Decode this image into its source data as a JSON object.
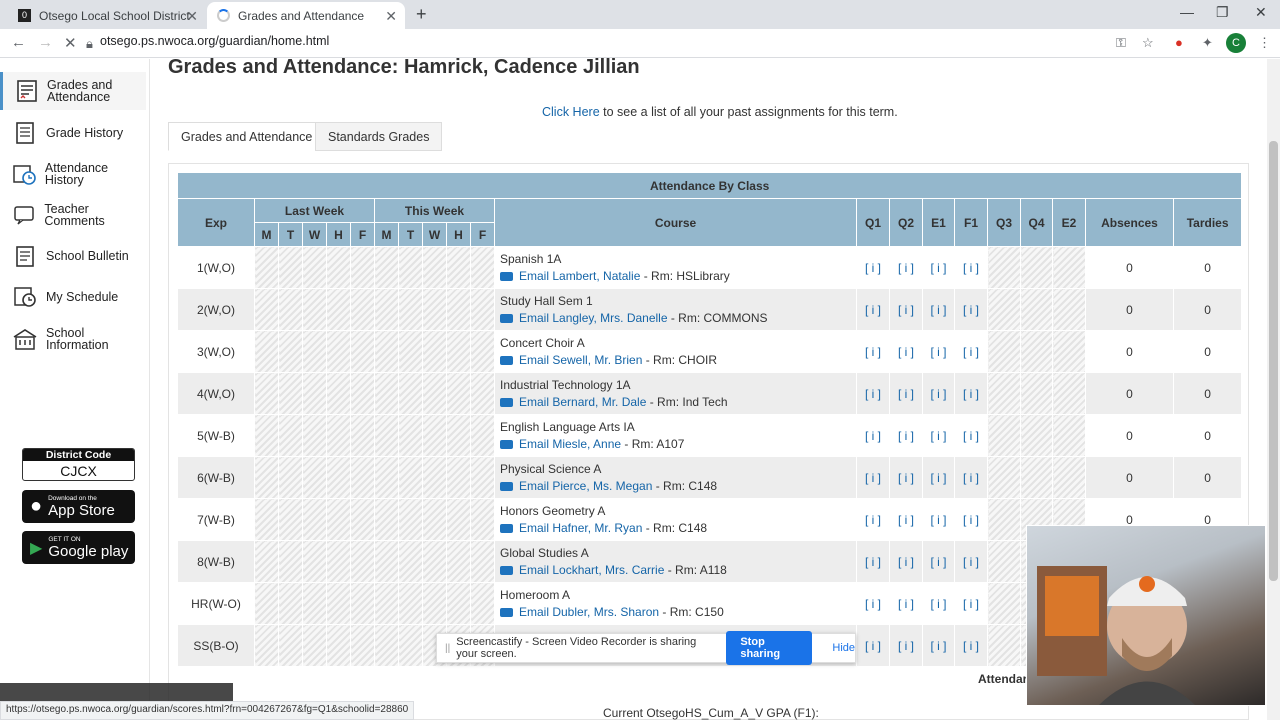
{
  "browser": {
    "tabs": [
      {
        "title": "Otsego Local School District"
      },
      {
        "title": "Grades and Attendance"
      }
    ],
    "url": "otsego.ps.nwoca.org/guardian/home.html",
    "profile_initial": "C"
  },
  "sidebar": {
    "items": [
      {
        "label": "Grades and Attendance",
        "icon": "grades-icon"
      },
      {
        "label": "Grade History",
        "icon": "grade-history-icon"
      },
      {
        "label": "Attendance History",
        "icon": "attendance-history-icon"
      },
      {
        "label": "Teacher Comments",
        "icon": "teacher-comments-icon"
      },
      {
        "label": "School Bulletin",
        "icon": "bulletin-icon"
      },
      {
        "label": "My Schedule",
        "icon": "schedule-icon"
      },
      {
        "label": "School Information",
        "icon": "school-icon"
      }
    ],
    "district_code_label": "District Code",
    "district_code": "CJCX",
    "app_store_small": "Download on the",
    "app_store_big": "App Store",
    "google_play_small": "GET IT ON",
    "google_play_big": "Google play"
  },
  "page": {
    "title": "Grades and Attendance: Hamrick, Cadence Jillian",
    "click_here": "Click Here",
    "click_here_rest": " to see a list of all your past assignments for this term.",
    "tabs": [
      "Grades and Attendance",
      "Standards Grades"
    ]
  },
  "table": {
    "caption": "Attendance By Class",
    "headers": {
      "exp": "Exp",
      "last_week": "Last Week",
      "this_week": "This Week",
      "days": [
        "M",
        "T",
        "W",
        "H",
        "F"
      ],
      "course": "Course",
      "terms": [
        "Q1",
        "Q2",
        "E1",
        "F1",
        "Q3",
        "Q4",
        "E2"
      ],
      "absences": "Absences",
      "tardies": "Tardies"
    },
    "rows": [
      {
        "exp": "1(W,O)",
        "course": "Spanish 1A",
        "email": "Email Lambert, Natalie",
        "room": " - Rm: HSLibrary",
        "q1": "[ i ]",
        "q2": "[ i ]",
        "e1": "[ i ]",
        "f1": "[ i ]",
        "absences": "0",
        "tardies": "0"
      },
      {
        "exp": "2(W,O)",
        "course": "Study Hall Sem 1",
        "email": "Email Langley, Mrs. Danelle",
        "room": " - Rm: COMMONS",
        "q1": "[ i ]",
        "q2": "[ i ]",
        "e1": "[ i ]",
        "f1": "[ i ]",
        "absences": "0",
        "tardies": "0"
      },
      {
        "exp": "3(W,O)",
        "course": "Concert Choir A",
        "email": "Email Sewell, Mr. Brien",
        "room": " - Rm: CHOIR",
        "q1": "[ i ]",
        "q2": "[ i ]",
        "e1": "[ i ]",
        "f1": "[ i ]",
        "absences": "0",
        "tardies": "0"
      },
      {
        "exp": "4(W,O)",
        "course": "Industrial Technology 1A",
        "email": "Email Bernard, Mr. Dale",
        "room": " - Rm: Ind Tech",
        "q1": "[ i ]",
        "q2": "[ i ]",
        "e1": "[ i ]",
        "f1": "[ i ]",
        "absences": "0",
        "tardies": "0"
      },
      {
        "exp": "5(W-B)",
        "course": "English Language Arts IA",
        "email": "Email Miesle, Anne",
        "room": " - Rm: A107",
        "q1": "[ i ]",
        "q2": "[ i ]",
        "e1": "[ i ]",
        "f1": "[ i ]",
        "absences": "0",
        "tardies": "0"
      },
      {
        "exp": "6(W-B)",
        "course": "Physical Science A",
        "email": "Email Pierce, Ms. Megan",
        "room": " - Rm: C148",
        "q1": "[ i ]",
        "q2": "[ i ]",
        "e1": "[ i ]",
        "f1": "[ i ]",
        "absences": "0",
        "tardies": "0"
      },
      {
        "exp": "7(W-B)",
        "course": "Honors Geometry A",
        "email": "Email Hafner, Mr. Ryan",
        "room": " - Rm: C148",
        "q1": "[ i ]",
        "q2": "[ i ]",
        "e1": "[ i ]",
        "f1": "[ i ]",
        "absences": "0",
        "tardies": "0"
      },
      {
        "exp": "8(W-B)",
        "course": "Global Studies A",
        "email": "Email Lockhart, Mrs. Carrie",
        "room": " - Rm: A118",
        "q1": "[ i ]",
        "q2": "[ i ]",
        "e1": "[ i ]",
        "f1": "[ i ]",
        "absences": "",
        "tardies": ""
      },
      {
        "exp": "HR(W-O)",
        "course": "Homeroom A",
        "email": "Email Dubler, Mrs. Sharon",
        "room": " - Rm: C150",
        "q1": "[ i ]",
        "q2": "[ i ]",
        "e1": "[ i ]",
        "f1": "[ i ]",
        "absences": "",
        "tardies": ""
      },
      {
        "exp": "SS(B-O)",
        "course": "",
        "email": "",
        "room": "",
        "q1": "[ i ]",
        "q2": "[ i ]",
        "e1": "[ i ]",
        "f1": "[ i ]",
        "absences": "",
        "tardies": ""
      }
    ],
    "footer_partial": "Attendar"
  },
  "status_url": "https://otsego.ps.nwoca.org/guardian/scores.html?frn=004267267&fg=Q1&schoolid=28860",
  "gpa_line": "Current OtsegoHS_Cum_A_V GPA (F1):",
  "screencastify": {
    "message": "Screencastify - Screen Video Recorder is sharing your screen.",
    "stop": "Stop sharing",
    "hide": "Hide"
  },
  "colors": {
    "header_blue": "#94b7cc",
    "link": "#1565a8",
    "stop_button": "#1a73e8"
  }
}
